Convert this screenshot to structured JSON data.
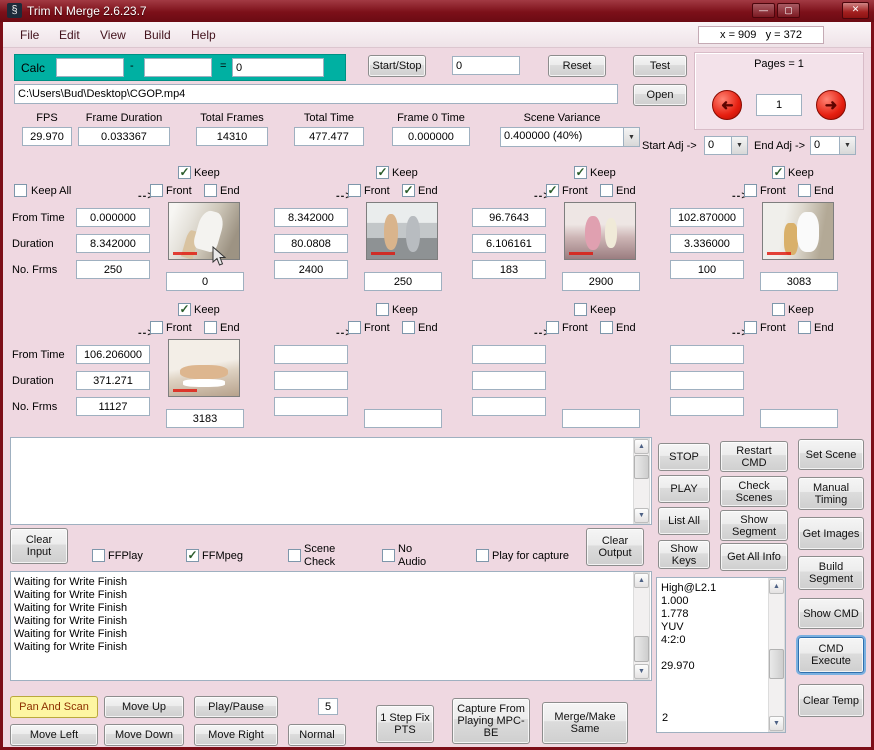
{
  "icons": {
    "app": "§",
    "minimize": "—",
    "maximize": "▢",
    "close": "✕",
    "dropdown": "▼",
    "scroll_up": "▲",
    "scroll_down": "▼",
    "page_prev": "➜",
    "page_next": "➜",
    "arrow": "-->"
  },
  "titlebar": {
    "title": "Trim N Merge 2.6.23.7"
  },
  "menubar": {
    "items": [
      "File",
      "Edit",
      "View",
      "Build",
      "Help"
    ],
    "coords": "x = 909   y = 372"
  },
  "calc": {
    "label": "Calc",
    "minus": "-",
    "equals": "=",
    "field_a": "",
    "field_b": "",
    "result": "0"
  },
  "transport": {
    "start_stop": "Start/Stop",
    "counter": "0",
    "reset": "Reset",
    "test": "Test"
  },
  "pages": {
    "label": "Pages = 1",
    "value": "1"
  },
  "file": {
    "path": "C:\\Users\\Bud\\Desktop\\CGOP.mp4",
    "open": "Open"
  },
  "stats": {
    "fps_label": "FPS",
    "fps": "29.970",
    "frame_duration_label": "Frame Duration",
    "frame_duration": "0.033367",
    "total_frames_label": "Total Frames",
    "total_frames": "14310",
    "total_time_label": "Total Time",
    "total_time": "477.477",
    "frame0_label": "Frame 0 Time",
    "frame0": "0.000000",
    "scene_variance_label": "Scene Variance",
    "scene_variance": "0.400000  (40%)",
    "start_adj_label": "Start Adj ->",
    "start_adj": "0",
    "end_adj_label": "End Adj ->",
    "end_adj": "0"
  },
  "grid": {
    "keep_all": "Keep All",
    "keep_all_checked": false,
    "labels": {
      "keep": "Keep",
      "front": "Front",
      "end": "End"
    },
    "row_labels": [
      "From Time",
      "Duration",
      "No. Frms"
    ],
    "segments": [
      {
        "keep": true,
        "front": false,
        "end": false,
        "from": "0.000000",
        "dur": "8.342000",
        "frms": "250",
        "frame": "0"
      },
      {
        "keep": true,
        "front": false,
        "end": true,
        "from": "8.342000",
        "dur": "80.0808",
        "frms": "2400",
        "frame": "250"
      },
      {
        "keep": true,
        "front": true,
        "end": false,
        "from": "96.7643",
        "dur": "6.106161",
        "frms": "183",
        "frame": "2900"
      },
      {
        "keep": true,
        "front": false,
        "end": false,
        "from": "102.870000",
        "dur": "3.336000",
        "frms": "100",
        "frame": "3083"
      },
      {
        "keep": true,
        "front": false,
        "end": false,
        "from": "106.206000",
        "dur": "371.271",
        "frms": "11127",
        "frame": "3183"
      },
      {
        "keep": false,
        "front": false,
        "end": false,
        "from": "",
        "dur": "",
        "frms": "",
        "frame": ""
      },
      {
        "keep": false,
        "front": false,
        "end": false,
        "from": "",
        "dur": "",
        "frms": "",
        "frame": ""
      },
      {
        "keep": false,
        "front": false,
        "end": false,
        "from": "",
        "dur": "",
        "frms": "",
        "frame": ""
      }
    ]
  },
  "actions": {
    "stop": "STOP",
    "play": "PLAY",
    "list_all": "List All",
    "show_keys": "Show Keys",
    "restart_cmd": "Restart CMD",
    "check_scenes": "Check Scenes",
    "show_segment": "Show Segment",
    "get_all_info": "Get All Info",
    "set_scene": "Set Scene",
    "manual_timing": "Manual Timing",
    "get_images": "Get Images",
    "build_segment": "Build Segment",
    "show_cmd": "Show CMD",
    "cmd_execute": "CMD Execute",
    "clear_temp": "Clear Temp"
  },
  "options": {
    "clear_input": "Clear Input",
    "ffplay": "FFPlay",
    "ffmpeg": "FFMpeg",
    "scene_check": "Scene Check",
    "no_audio": "No Audio",
    "play_for_capture": "Play for capture",
    "clear_output": "Clear Output",
    "checks": {
      "ffplay": false,
      "ffmpeg": true,
      "scene_check": false,
      "no_audio": false,
      "play_for_capture": false
    }
  },
  "log": {
    "lines": [
      "Waiting for Write Finish",
      "Waiting for Write Finish",
      "Waiting for Write Finish",
      "Waiting for Write Finish",
      "Waiting for Write Finish",
      "Waiting for Write Finish"
    ]
  },
  "info": {
    "lines": [
      "High@L2.1",
      "1.000",
      "1.778",
      "YUV",
      "4:2:0",
      "",
      "29.970"
    ],
    "bottom": "2"
  },
  "bottom": {
    "pan_and_scan": "Pan And Scan",
    "move_up": "Move Up",
    "play_pause": "Play/Pause",
    "step": "5",
    "fix_pts": "1 Step Fix PTS",
    "capture": "Capture From Playing MPC-BE",
    "merge_make": "Merge/Make Same",
    "move_left": "Move Left",
    "move_down": "Move Down",
    "move_right": "Move Right",
    "normal": "Normal"
  }
}
